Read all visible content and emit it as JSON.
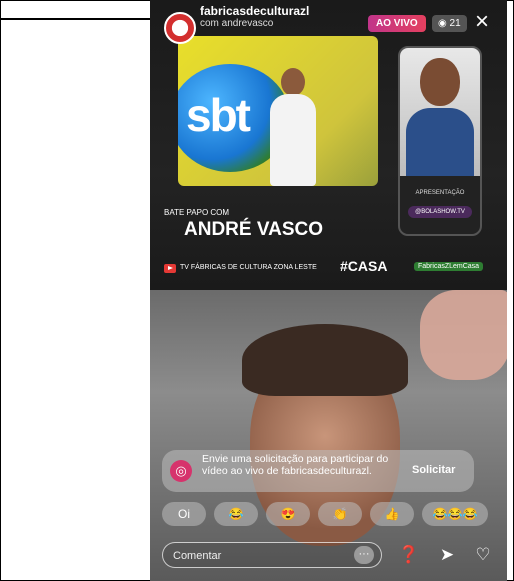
{
  "header": {
    "username": "fabricasdeculturazl",
    "with_line": "com andrevasco",
    "live_label": "AO VIVO",
    "viewer_count": "21",
    "viewer_icon": "eye-icon",
    "close_icon": "close-icon"
  },
  "broadcast": {
    "sbt_logo_text": "sbt",
    "bate_papo": "BATE PAPO COM",
    "guest_name": "ANDRÉ VASCO",
    "tv_label": "TV FÁBRICAS DE CULTURA ZONA LESTE",
    "culture_tag": "#CASA",
    "fabricas_tag": "FabricasZLemCasa",
    "presenter_label": "APRESENTAÇÃO",
    "presenter_handle": "@BOLASHOW.TV"
  },
  "request": {
    "text": "Envie uma solicitação para participar do vídeo ao vivo de fabricasdeculturazl.",
    "button_label": "Solicitar",
    "icon": "join-live-icon"
  },
  "quick_reactions": [
    {
      "label": "Oi",
      "icon": "text"
    },
    {
      "label": "😂",
      "icon": "laugh-emoji-icon"
    },
    {
      "label": "😍",
      "icon": "heart-eyes-emoji-icon"
    },
    {
      "label": "👏",
      "icon": "clap-emoji-icon"
    },
    {
      "label": "👍",
      "icon": "thumbs-up-emoji-icon"
    },
    {
      "label": "😂😂😂",
      "icon": "triple-laugh-emoji-icon"
    }
  ],
  "comment_bar": {
    "placeholder": "Comentar",
    "more_label": "···",
    "gift_icon": "question-gift-icon",
    "send_icon": "send-icon",
    "like_icon": "heart-icon"
  },
  "colors": {
    "live_badge": "#e4405f",
    "request_icon": "#d6336c"
  }
}
